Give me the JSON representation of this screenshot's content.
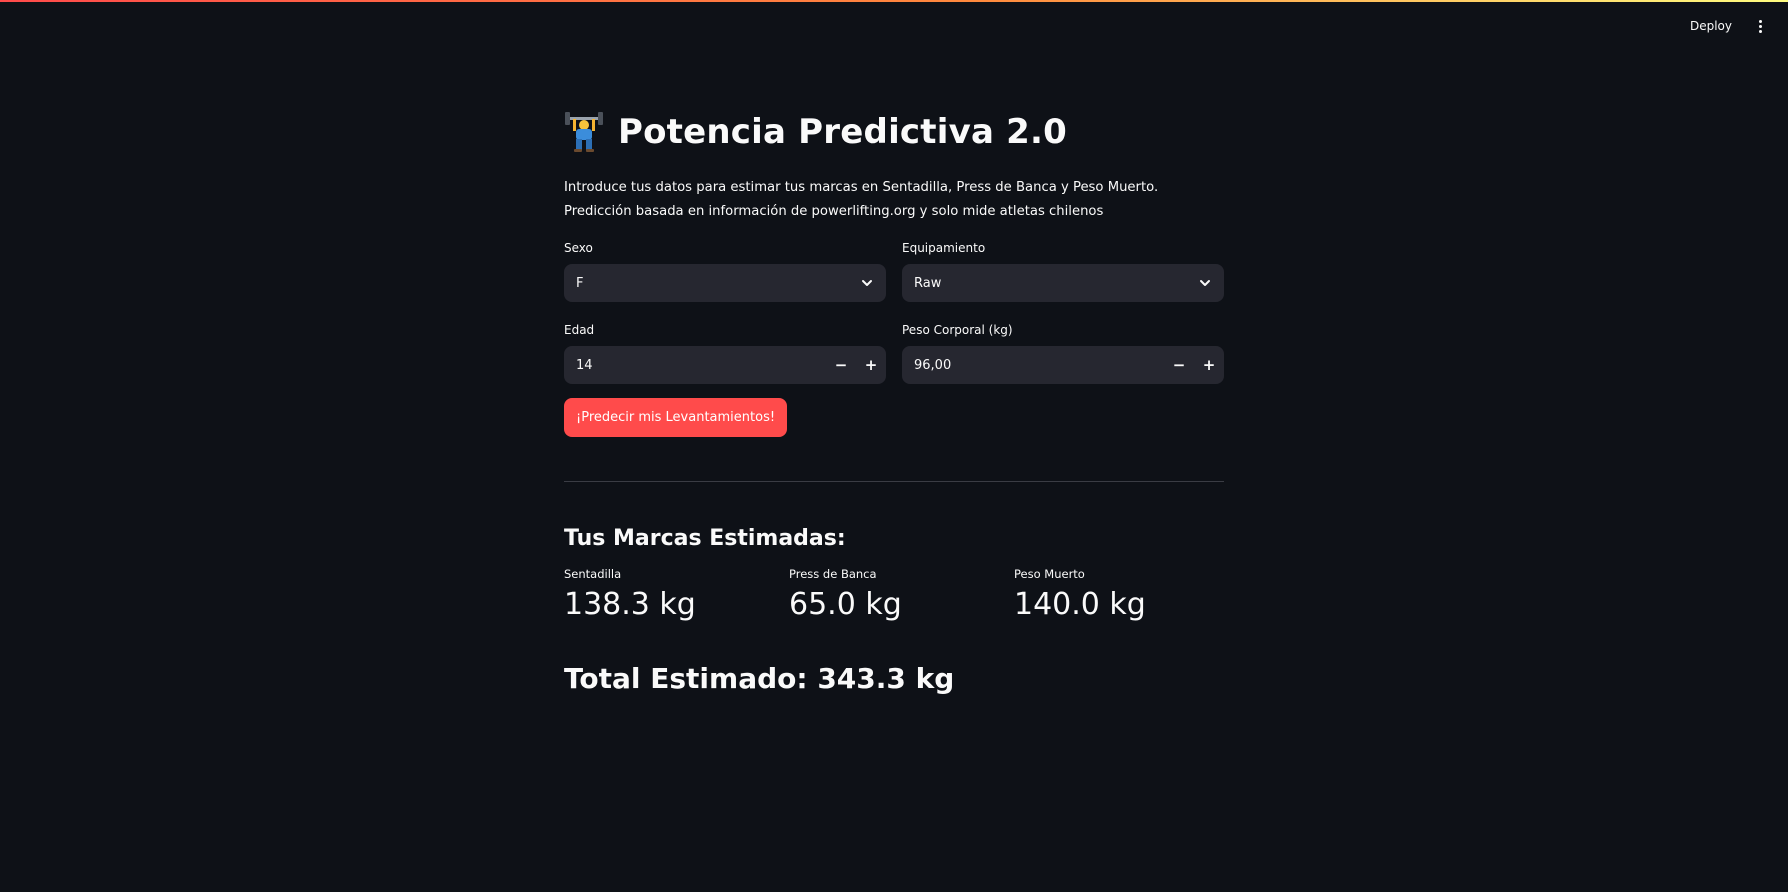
{
  "header": {
    "deploy_label": "Deploy",
    "menu_icon": "kebab-menu-icon",
    "accent_gradient": [
      "#ff4b4b",
      "#ff8a3d",
      "#fffd80"
    ]
  },
  "app": {
    "title_icon": "weightlifter-emoji-icon",
    "title": "Potencia Predictiva 2.0",
    "intro": "Introduce tus datos para estimar tus marcas en Sentadilla, Press de Banca y Peso Muerto. Predicción basada en información de powerlifting.org y solo mide atletas chilenos"
  },
  "form": {
    "sexo": {
      "label": "Sexo",
      "value": "F"
    },
    "equipamiento": {
      "label": "Equipamiento",
      "value": "Raw"
    },
    "edad": {
      "label": "Edad",
      "value": "14",
      "minus": "−",
      "plus": "+"
    },
    "peso": {
      "label": "Peso Corporal (kg)",
      "value": "96,00",
      "minus": "−",
      "plus": "+"
    },
    "submit_label": "¡Predecir mis Levantamientos!"
  },
  "results": {
    "heading": "Tus Marcas Estimadas:",
    "metrics": [
      {
        "label": "Sentadilla",
        "value": "138.3 kg"
      },
      {
        "label": "Press de Banca",
        "value": "65.0 kg"
      },
      {
        "label": "Peso Muerto",
        "value": "140.0 kg"
      }
    ],
    "total": "Total Estimado: 343.3 kg"
  },
  "colors": {
    "background": "#0e1117",
    "input_bg": "#262730",
    "primary": "#ff4b4b",
    "text": "#fafafa"
  }
}
